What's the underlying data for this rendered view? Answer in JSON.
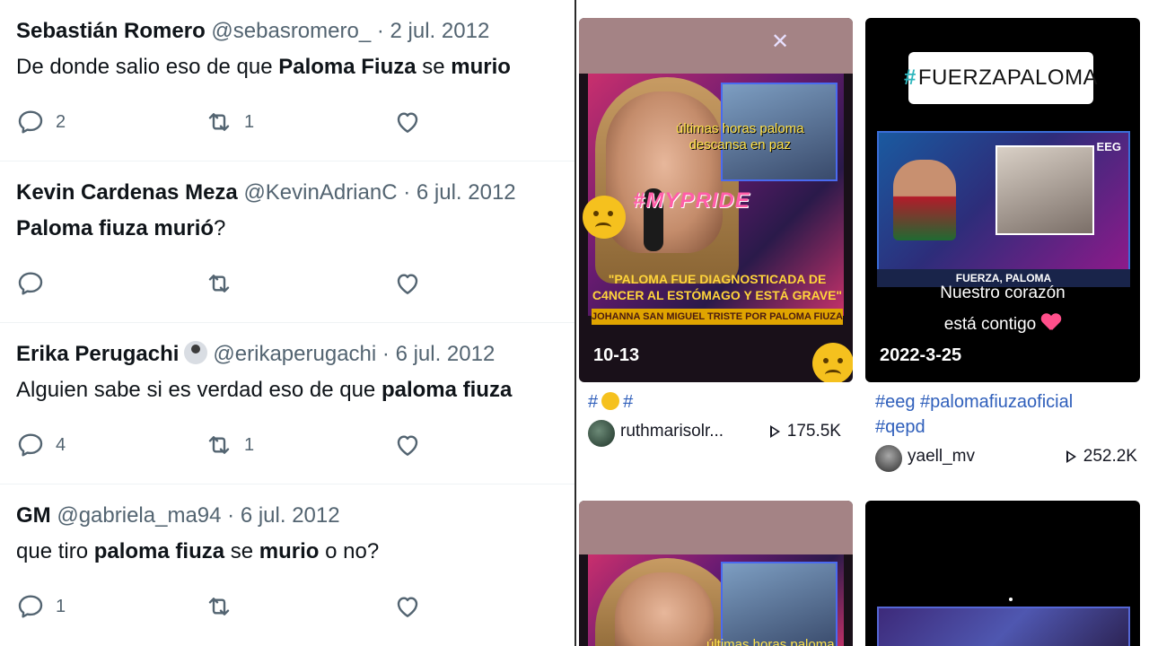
{
  "tweets": [
    {
      "name": "Sebastián Romero",
      "handle": "@sebasromero_",
      "sep": "·",
      "date": "2 jul. 2012",
      "text": [
        {
          "t": "De donde salio eso de que ",
          "b": false
        },
        {
          "t": "Paloma Fiuza",
          "b": true
        },
        {
          "t": " se ",
          "b": false
        },
        {
          "t": "murio",
          "b": true
        }
      ],
      "replies": "2",
      "retweets": "1",
      "likes": ""
    },
    {
      "name": "Kevin Cardenas Meza",
      "handle": "@KevinAdrianC",
      "sep": "·",
      "date": "6 jul. 2012",
      "text": [
        {
          "t": "Paloma fiuza murió",
          "b": true
        },
        {
          "t": "?",
          "b": false
        }
      ],
      "replies": "",
      "retweets": "",
      "likes": ""
    },
    {
      "name": "Erika Perugachi",
      "handle": "@erikaperugachi",
      "sep": "·",
      "date": "6 jul. 2012",
      "has_emoji": true,
      "text": [
        {
          "t": "Alguien sabe si es verdad eso de que ",
          "b": false
        },
        {
          "t": "paloma fiuza",
          "b": true
        }
      ],
      "replies": "4",
      "retweets": "1",
      "likes": ""
    },
    {
      "name": "GM",
      "handle": "@gabriela_ma94",
      "sep": "·",
      "date": "6 jul. 2012",
      "text": [
        {
          "t": "que tiro ",
          "b": false
        },
        {
          "t": "paloma fiuza",
          "b": true
        },
        {
          "t": " se ",
          "b": false
        },
        {
          "t": "murio",
          "b": true
        },
        {
          "t": " o no?",
          "b": false
        }
      ],
      "replies": "1",
      "retweets": "",
      "likes": ""
    }
  ],
  "icons": {
    "reply": "reply-icon",
    "retweet": "retweet-icon",
    "like": "heart-icon",
    "play": "play-icon"
  },
  "colors": {
    "text": "#0f1419",
    "muted": "#536471",
    "hashtag": "#2f5fbb",
    "tag_hash": "#2eb6bd"
  },
  "videos": [
    {
      "overlay_line1": "últimas horas paloma",
      "overlay_line2": "descansa en paz",
      "myp": "#MYPRIDE",
      "quote": "\"PALOMA FUE DIAGNOSTICADA DE C4NCER AL ESTÓMAGO Y ESTÁ GRAVE\"",
      "band": "JOHANNA SAN MIGUEL TRISTE POR PALOMA FIUZA",
      "date": "10-13",
      "tags": [
        "#",
        "#"
      ],
      "user": "ruthmarisolr...",
      "views": "175.5K"
    },
    {
      "tag_hash": "#",
      "tag_text": "FUERZAPALOMA",
      "logo": "EEG",
      "band": "FUERZA, PALOMA",
      "cap1": "Nuestro corazón",
      "cap2": "está contigo",
      "date": "2022-3-25",
      "tags_line1": "#eeg #palomafiuzaoficial",
      "tags_line2": "#qepd",
      "user": "yaell_mv",
      "views": "252.2K"
    },
    {
      "overlay_line1": "últimas horas paloma"
    },
    {}
  ]
}
